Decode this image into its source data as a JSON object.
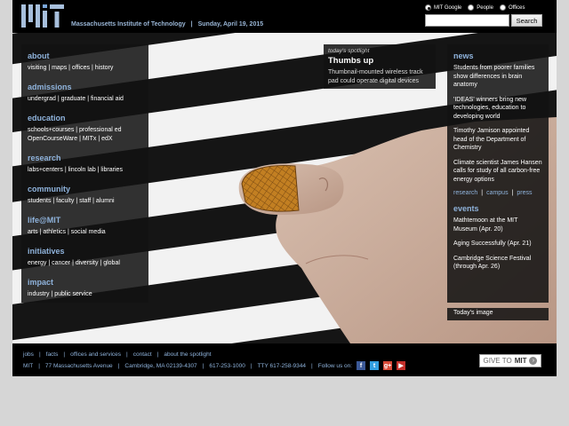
{
  "header": {
    "institute": "Massachusetts Institute of Technology",
    "separator": "|",
    "date": "Sunday, April 19, 2015",
    "logo_name": "mit-logo"
  },
  "search": {
    "options": [
      "MIT Google",
      "People",
      "Offices"
    ],
    "selected": "MIT Google",
    "value": "",
    "button_label": "Search"
  },
  "nav": [
    {
      "head": "about",
      "lines": [
        "visiting | maps | offices | history"
      ]
    },
    {
      "head": "admissions",
      "lines": [
        "undergrad | graduate | financial aid"
      ]
    },
    {
      "head": "education",
      "lines": [
        "schools+courses | professional ed",
        "OpenCourseWare | MITx | edX"
      ]
    },
    {
      "head": "research",
      "lines": [
        "labs+centers | lincoln lab | libraries"
      ]
    },
    {
      "head": "community",
      "lines": [
        "students | faculty | staff | alumni"
      ]
    },
    {
      "head": "life@MIT",
      "lines": [
        "arts | athletics | social media"
      ]
    },
    {
      "head": "initiatives",
      "lines": [
        "energy | cancer | diversity | global"
      ]
    },
    {
      "head": "impact",
      "lines": [
        "industry | public service"
      ]
    }
  ],
  "spotlight": {
    "kicker": "today's spotlight",
    "title": "Thumbs up",
    "text": "Thumbnail-mounted wireless track pad could operate digital devices"
  },
  "news": {
    "head": "news",
    "items": [
      "Students from poorer families show differences in brain anatomy",
      "'IDEAS' winners bring new technologies, education to developing world",
      "Timothy Jamison appointed head of the Department of Chemistry",
      "Climate scientist James Hansen calls for study of all carbon-free energy options"
    ],
    "links": [
      "research",
      "campus",
      "press"
    ]
  },
  "events": {
    "head": "events",
    "items": [
      "Mathtemoon at the MIT Museum (Apr. 20)",
      "Aging Successfully (Apr. 21)",
      "Cambridge Science Festival (through Apr. 26)"
    ]
  },
  "todays_image_label": "Today's image",
  "footer": {
    "row1": [
      "jobs",
      "facts",
      "offices and services",
      "contact",
      "about the spotlight"
    ],
    "row2": [
      "MIT",
      "77 Massachusetts Avenue",
      "Cambridge, MA 02139-4307",
      "617-253-1000",
      "TTY 617-258-9344",
      "Follow us on:"
    ],
    "social_icons": [
      "facebook-icon",
      "twitter-icon",
      "google-plus-icon",
      "youtube-icon"
    ],
    "social_colors": [
      "#3b5998",
      "#33a0e0",
      "#d84a38",
      "#c4302b"
    ],
    "give": {
      "prefix": "GIVE TO",
      "mit": "MIT"
    }
  },
  "colors": {
    "accent": "#8fb3dc",
    "header_bg": "#000000",
    "page_bg": "#d6d6d6"
  }
}
